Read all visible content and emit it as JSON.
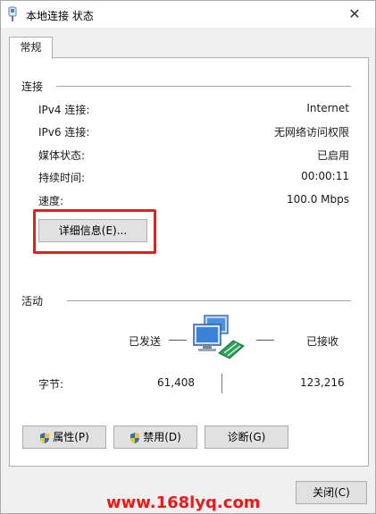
{
  "window": {
    "title": "本地连接 状态",
    "close_glyph": "✕"
  },
  "tabs": [
    {
      "label": "常规"
    }
  ],
  "connection": {
    "section_label": "连接",
    "rows": [
      {
        "label": "IPv4 连接:",
        "value": "Internet"
      },
      {
        "label": "IPv6 连接:",
        "value": "无网络访问权限"
      },
      {
        "label": "媒体状态:",
        "value": "已启用"
      },
      {
        "label": "持续时间:",
        "value": "00:00:11"
      },
      {
        "label": "速度:",
        "value": "100.0 Mbps"
      }
    ],
    "details_button": "详细信息(E)..."
  },
  "activity": {
    "section_label": "活动",
    "sent_label": "已发送",
    "received_label": "已接收",
    "bytes_label": "字节:",
    "bytes_sent": "61,408",
    "bytes_received": "123,216"
  },
  "actions": {
    "properties": "属性(P)",
    "disable": "禁用(D)",
    "diagnose": "诊断(G)"
  },
  "footer": {
    "close": "关闭(C)"
  },
  "watermark": "www.168lyq.com",
  "colors": {
    "highlight": "#e02020",
    "watermark": "#e81a1a"
  }
}
